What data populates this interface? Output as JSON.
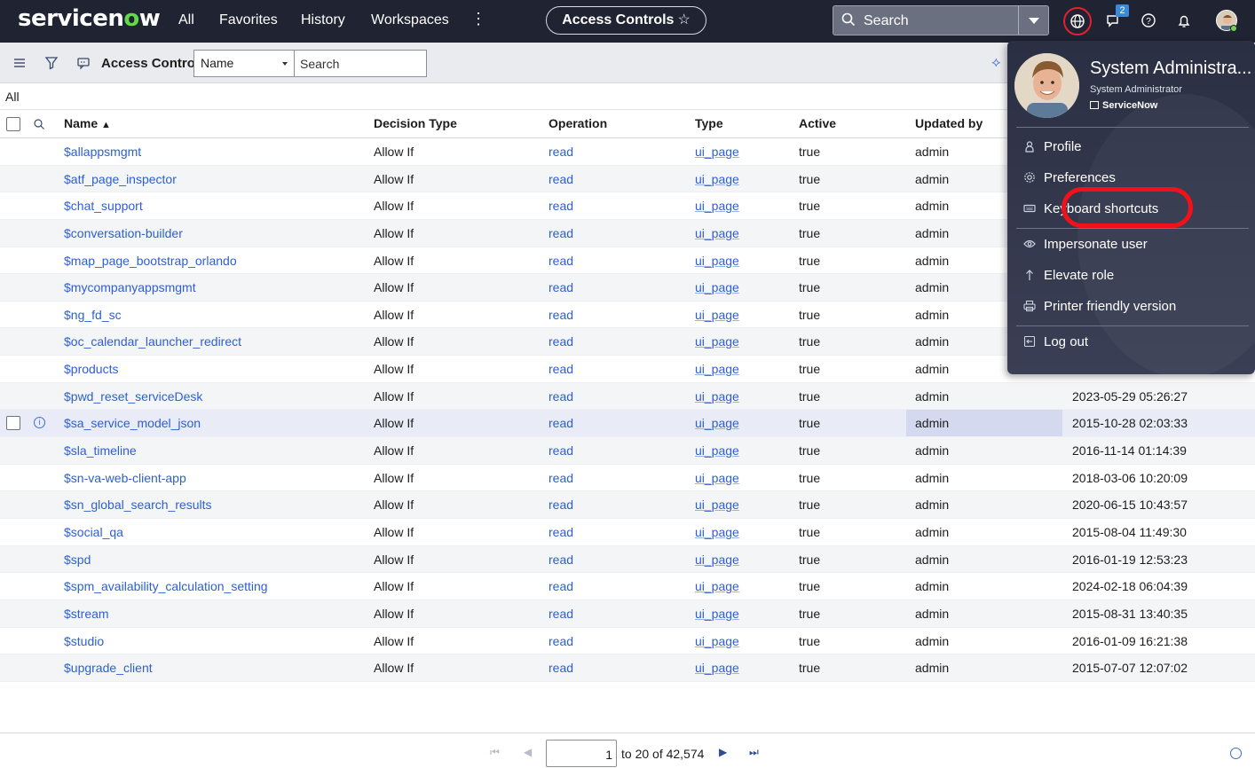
{
  "topnav": {
    "logo_pre": "servicen",
    "logo_o": "o",
    "logo_post": "w",
    "links": [
      "All",
      "Favorites",
      "History",
      "Workspaces"
    ],
    "more": "⋮",
    "context_pill": "Access Controls",
    "pill_star": "☆",
    "search_placeholder": "Search",
    "notifications_badge": "2",
    "accent_color": "#62d84e",
    "bg_color": "#1f2332"
  },
  "listbar": {
    "title": "Access Controls",
    "field_select": "Name",
    "search_placeholder": "Search"
  },
  "breadcrumb": "All",
  "table": {
    "columns": [
      "Name",
      "Decision Type",
      "Operation",
      "Type",
      "Active",
      "Updated by"
    ],
    "sort_arrow": "▲",
    "rows": [
      {
        "name": "$allappsmgmt",
        "decision": "Allow If",
        "op": "read",
        "type": "ui_page",
        "active": "true",
        "by": "admin",
        "updated": ""
      },
      {
        "name": "$atf_page_inspector",
        "decision": "Allow If",
        "op": "read",
        "type": "ui_page",
        "active": "true",
        "by": "admin",
        "updated": ""
      },
      {
        "name": "$chat_support",
        "decision": "Allow If",
        "op": "read",
        "type": "ui_page",
        "active": "true",
        "by": "admin",
        "updated": ""
      },
      {
        "name": "$conversation-builder",
        "decision": "Allow If",
        "op": "read",
        "type": "ui_page",
        "active": "true",
        "by": "admin",
        "updated": ""
      },
      {
        "name": "$map_page_bootstrap_orlando",
        "decision": "Allow If",
        "op": "read",
        "type": "ui_page",
        "active": "true",
        "by": "admin",
        "updated": ""
      },
      {
        "name": "$mycompanyappsmgmt",
        "decision": "Allow If",
        "op": "read",
        "type": "ui_page",
        "active": "true",
        "by": "admin",
        "updated": ""
      },
      {
        "name": "$ng_fd_sc",
        "decision": "Allow If",
        "op": "read",
        "type": "ui_page",
        "active": "true",
        "by": "admin",
        "updated": ""
      },
      {
        "name": "$oc_calendar_launcher_redirect",
        "decision": "Allow If",
        "op": "read",
        "type": "ui_page",
        "active": "true",
        "by": "admin",
        "updated": ""
      },
      {
        "name": "$products",
        "decision": "Allow If",
        "op": "read",
        "type": "ui_page",
        "active": "true",
        "by": "admin",
        "updated": ""
      },
      {
        "name": "$pwd_reset_serviceDesk",
        "decision": "Allow If",
        "op": "read",
        "type": "ui_page",
        "active": "true",
        "by": "admin",
        "updated": "2023-05-29 05:26:27"
      },
      {
        "name": "$sa_service_model_json",
        "decision": "Allow If",
        "op": "read",
        "type": "ui_page",
        "active": "true",
        "by": "admin",
        "updated": "2015-10-28 02:03:33"
      },
      {
        "name": "$sla_timeline",
        "decision": "Allow If",
        "op": "read",
        "type": "ui_page",
        "active": "true",
        "by": "admin",
        "updated": "2016-11-14 01:14:39"
      },
      {
        "name": "$sn-va-web-client-app",
        "decision": "Allow If",
        "op": "read",
        "type": "ui_page",
        "active": "true",
        "by": "admin",
        "updated": "2018-03-06 10:20:09"
      },
      {
        "name": "$sn_global_search_results",
        "decision": "Allow If",
        "op": "read",
        "type": "ui_page",
        "active": "true",
        "by": "admin",
        "updated": "2020-06-15 10:43:57"
      },
      {
        "name": "$social_qa",
        "decision": "Allow If",
        "op": "read",
        "type": "ui_page",
        "active": "true",
        "by": "admin",
        "updated": "2015-08-04 11:49:30"
      },
      {
        "name": "$spd",
        "decision": "Allow If",
        "op": "read",
        "type": "ui_page",
        "active": "true",
        "by": "admin",
        "updated": "2016-01-19 12:53:23"
      },
      {
        "name": "$spm_availability_calculation_setting",
        "decision": "Allow If",
        "op": "read",
        "type": "ui_page",
        "active": "true",
        "by": "admin",
        "updated": "2024-02-18 06:04:39"
      },
      {
        "name": "$stream",
        "decision": "Allow If",
        "op": "read",
        "type": "ui_page",
        "active": "true",
        "by": "admin",
        "updated": "2015-08-31 13:40:35"
      },
      {
        "name": "$studio",
        "decision": "Allow If",
        "op": "read",
        "type": "ui_page",
        "active": "true",
        "by": "admin",
        "updated": "2016-01-09 16:21:38"
      },
      {
        "name": "$upgrade_client",
        "decision": "Allow If",
        "op": "read",
        "type": "ui_page",
        "active": "true",
        "by": "admin",
        "updated": "2015-07-07 12:07:02"
      }
    ]
  },
  "pagination": {
    "first": "⏮",
    "prev": "◀",
    "next": "▶",
    "last": "⏭",
    "current": "1",
    "range_text": "to 20 of 42,574"
  },
  "user_menu": {
    "name": "System Administra...",
    "role": "System Administrator",
    "company": "ServiceNow",
    "items": [
      {
        "label": "Profile",
        "icon": "person-icon"
      },
      {
        "label": "Preferences",
        "icon": "gear-icon"
      },
      {
        "label": "Keyboard shortcuts",
        "icon": "keyboard-icon"
      },
      {
        "label": "Impersonate user",
        "icon": "eye-icon"
      },
      {
        "label": "Elevate role",
        "icon": "arrow-up-icon"
      },
      {
        "label": "Printer friendly version",
        "icon": "printer-icon"
      },
      {
        "label": "Log out",
        "icon": "logout-icon"
      }
    ]
  }
}
